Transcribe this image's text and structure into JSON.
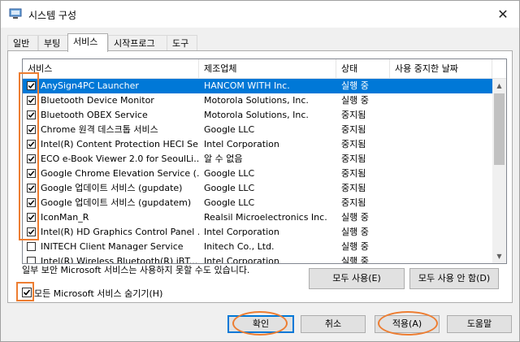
{
  "window": {
    "title": "시스템 구성",
    "close_label": "✕"
  },
  "tabs": [
    {
      "label": "일반"
    },
    {
      "label": "부팅"
    },
    {
      "label": "서비스"
    },
    {
      "label": "시작프로그램"
    },
    {
      "label": "도구"
    }
  ],
  "active_tab": "서비스",
  "table": {
    "columns": [
      "서비스",
      "제조업체",
      "상태",
      "사용 중지한 날짜"
    ],
    "rows": [
      {
        "service": "AnySign4PC Launcher",
        "vendor": "HANCOM WITH Inc.",
        "status": "실행 중",
        "checked": true,
        "selected": true
      },
      {
        "service": "Bluetooth Device Monitor",
        "vendor": "Motorola Solutions, Inc.",
        "status": "실행 중",
        "checked": true
      },
      {
        "service": "Bluetooth OBEX Service",
        "vendor": "Motorola Solutions, Inc.",
        "status": "중지됨",
        "checked": true
      },
      {
        "service": "Chrome 원격 데스크톱 서비스",
        "vendor": "Google LLC",
        "status": "중지됨",
        "checked": true
      },
      {
        "service": "Intel(R) Content Protection HECI Se...",
        "vendor": "Intel Corporation",
        "status": "중지됨",
        "checked": true
      },
      {
        "service": "ECO e-Book Viewer 2.0 for SeoulLi...",
        "vendor": "알 수 없음",
        "status": "중지됨",
        "checked": true
      },
      {
        "service": "Google Chrome Elevation Service (...",
        "vendor": "Google LLC",
        "status": "중지됨",
        "checked": true
      },
      {
        "service": "Google 업데이트 서비스 (gupdate)",
        "vendor": "Google LLC",
        "status": "중지됨",
        "checked": true
      },
      {
        "service": "Google 업데이트 서비스 (gupdatem)",
        "vendor": "Google LLC",
        "status": "중지됨",
        "checked": true
      },
      {
        "service": "IconMan_R",
        "vendor": "Realsil Microelectronics Inc.",
        "status": "실행 중",
        "checked": true
      },
      {
        "service": "Intel(R) HD Graphics Control Panel ...",
        "vendor": "Intel Corporation",
        "status": "실행 중",
        "checked": true
      },
      {
        "service": "INITECH Client Manager Service",
        "vendor": "Initech Co., Ltd.",
        "status": "실행 중",
        "checked": false
      },
      {
        "service": "Intel(R) Wireless Bluetooth(R) iBT...",
        "vendor": "Intel Corporation",
        "status": "실행 중",
        "checked": false
      }
    ]
  },
  "notice": "일부 보안 Microsoft 서비스는 사용하지 못할 수도 있습니다.",
  "enable_all_label": "모두 사용(E)",
  "disable_all_label": "모두 사용 안 함(D)",
  "hide_ms": {
    "label": "모든 Microsoft 서비스 숨기기(H)",
    "checked": true
  },
  "footer": {
    "ok_label": "확인",
    "cancel_label": "취소",
    "apply_label": "적용(A)",
    "help_label": "도움말"
  },
  "colors": {
    "selection": "#0078d7",
    "highlight": "#ed7d31"
  }
}
